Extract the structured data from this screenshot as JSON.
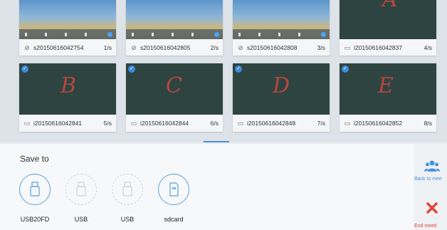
{
  "cards": [
    {
      "name": "s20150616042754",
      "page": "1/s",
      "kind": "screenshot",
      "letter": ""
    },
    {
      "name": "s20150616042805",
      "page": "2/s",
      "kind": "screenshot",
      "letter": ""
    },
    {
      "name": "s20150616042808",
      "page": "3/s",
      "kind": "screenshot",
      "letter": ""
    },
    {
      "name": "i20150616042837",
      "page": "4/s",
      "kind": "whiteboard",
      "letter": "A"
    },
    {
      "name": "i20150616042841",
      "page": "5/s",
      "kind": "whiteboard",
      "letter": "B"
    },
    {
      "name": "i20150616042844",
      "page": "6/s",
      "kind": "whiteboard",
      "letter": "C"
    },
    {
      "name": "i20150616042848",
      "page": "7/s",
      "kind": "whiteboard",
      "letter": "D"
    },
    {
      "name": "i20150616042852",
      "page": "8/s",
      "kind": "whiteboard",
      "letter": "E"
    }
  ],
  "save_panel": {
    "title": "Save to",
    "devices": [
      {
        "label": "USB20FD",
        "state": "available",
        "icon": "usb-drive-icon"
      },
      {
        "label": "USB",
        "state": "unavailable",
        "icon": "usb-drive-icon"
      },
      {
        "label": "USB",
        "state": "unavailable",
        "icon": "usb-drive-icon"
      },
      {
        "label": "sdcard",
        "state": "available",
        "icon": "sd-card-icon"
      }
    ]
  },
  "sidebar": {
    "back_label": "Back to mee",
    "end_label": "End meeti"
  },
  "colors": {
    "accent": "#3d8be0",
    "board": "#2e4440",
    "ink": "#b5463f",
    "end_red": "#e0453a"
  }
}
